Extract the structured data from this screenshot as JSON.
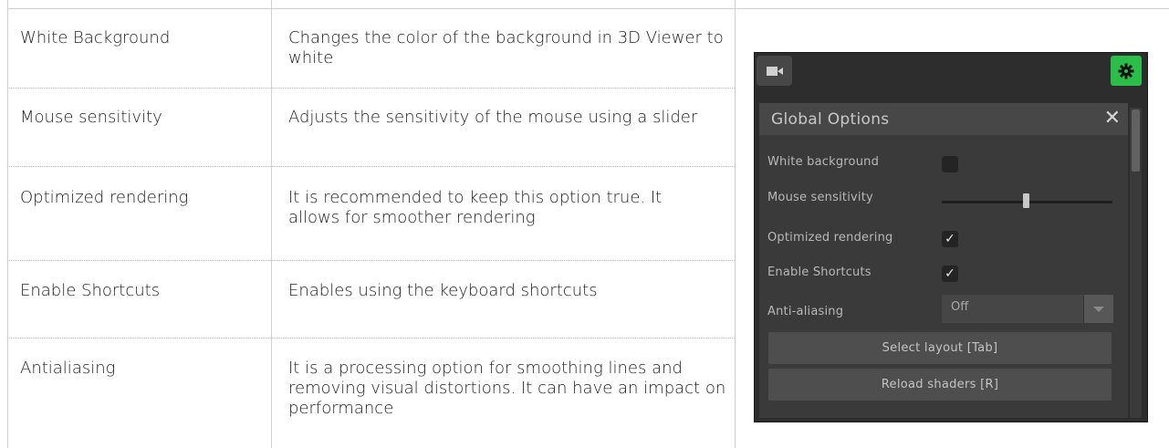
{
  "table": {
    "rows": [
      {
        "option": "White Background",
        "description": "Changes the color of the background in 3D Viewer to white"
      },
      {
        "option": "Mouse sensitivity",
        "description": "Adjusts the sensitivity of the mouse using a slider"
      },
      {
        "option": "Optimized rendering",
        "description": "It is recommended to keep this option true. It allows for smoother rendering"
      },
      {
        "option": "Enable Shortcuts",
        "description": "Enables using the keyboard shortcuts"
      },
      {
        "option": "Antialiasing",
        "description": "It is a processing option for smoothing lines and removing visual distortions. It can have an impact on performance"
      }
    ]
  },
  "panel": {
    "title": "Global Options",
    "close_glyph": "✕",
    "labels": {
      "white_background": "White background",
      "mouse_sensitivity": "Mouse sensitivity",
      "optimized_rendering": "Optimized rendering",
      "enable_shortcuts": "Enable Shortcuts",
      "anti_aliasing": "Anti-aliasing"
    },
    "values": {
      "white_background": false,
      "optimized_rendering": true,
      "enable_shortcuts": true,
      "mouse_sensitivity": 0.48,
      "anti_aliasing": "Off"
    },
    "check_glyph": "✓",
    "buttons": {
      "select_layout": "Select layout [Tab]",
      "reload_shaders": "Reload shaders [R]"
    },
    "icons": {
      "camera": "camera-icon",
      "settings": "gear-icon"
    },
    "colors": {
      "accent": "#2bbf49"
    }
  }
}
